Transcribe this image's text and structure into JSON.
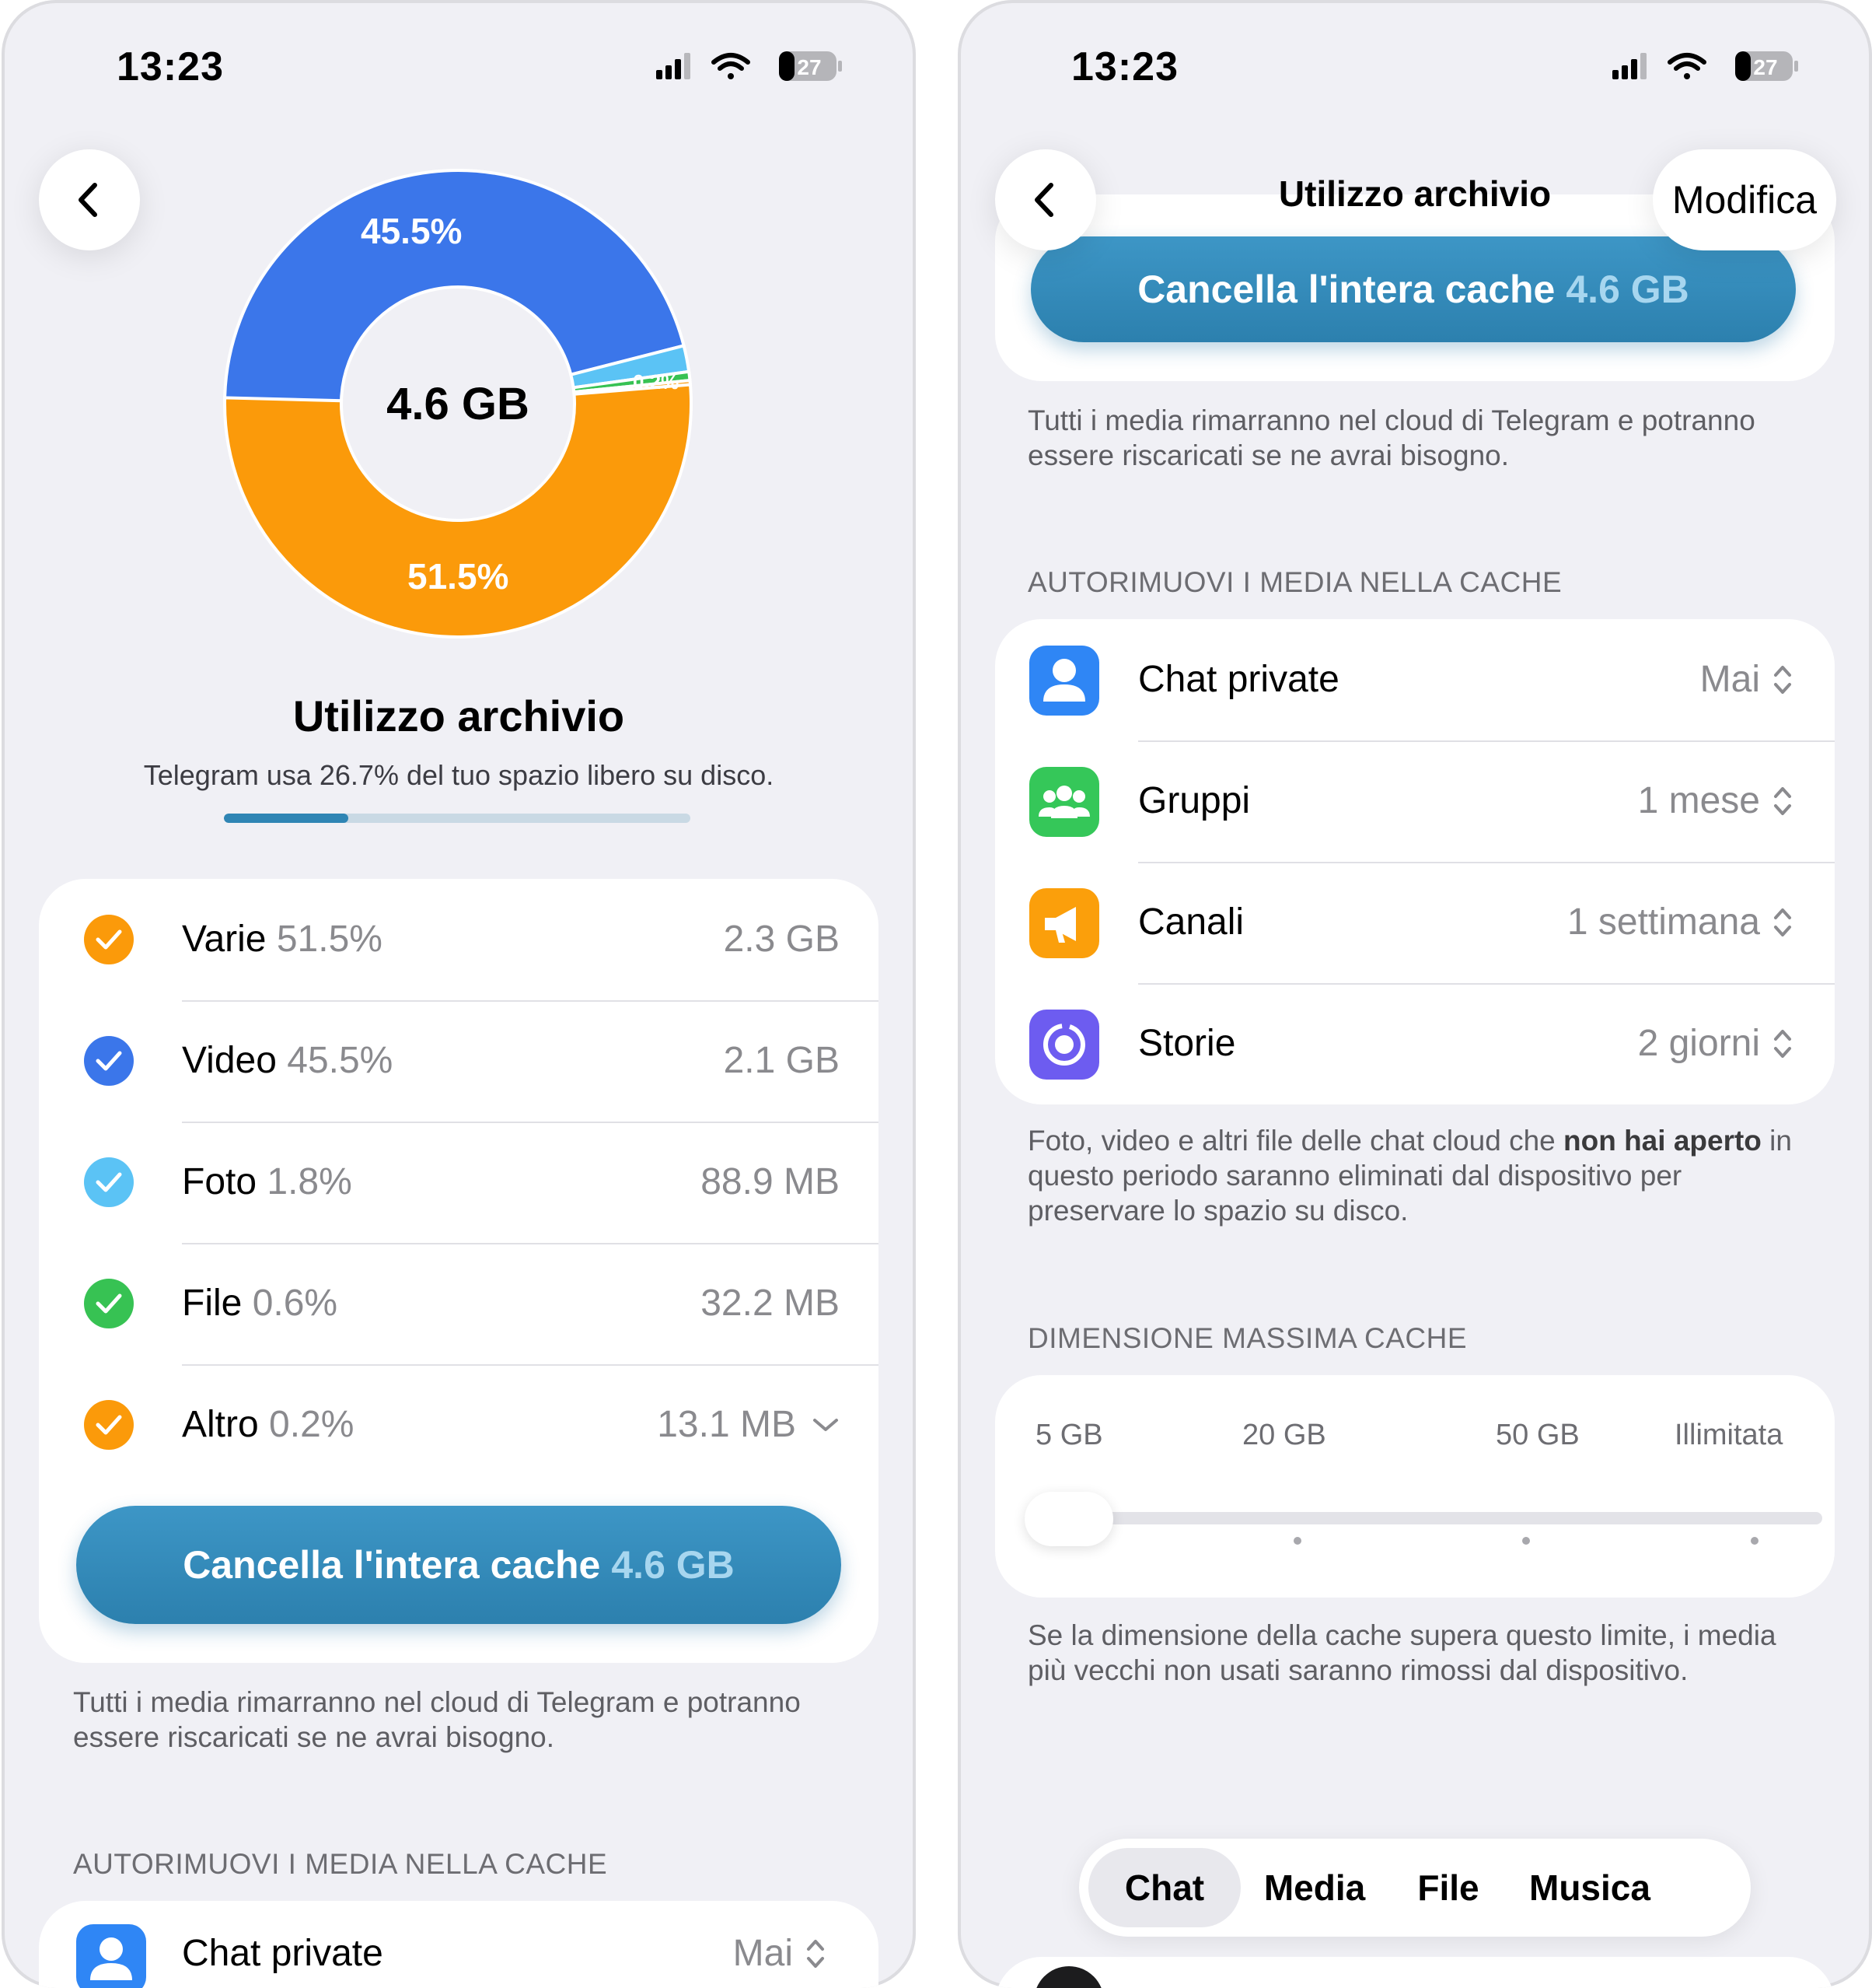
{
  "status_bar": {
    "time": "13:23",
    "battery": "27"
  },
  "left": {
    "chart_data": {
      "type": "pie",
      "center_label": "4.6 GB",
      "slice_labels": [
        "45.5%",
        "51.5%",
        "0.2%"
      ],
      "slices": [
        {
          "name": "Varie",
          "value": 51.5,
          "color": "#fb9a0a"
        },
        {
          "name": "Video",
          "value": 45.5,
          "color": "#3b76ea"
        },
        {
          "name": "Foto",
          "value": 1.8,
          "color": "#5bc3f5"
        },
        {
          "name": "File",
          "value": 0.6,
          "color": "#37c253"
        },
        {
          "name": "Altro",
          "value": 0.2,
          "color": "#fb9a0a"
        }
      ]
    },
    "title": "Utilizzo archivio",
    "subtitle": "Telegram usa 26.7% del tuo spazio libero su disco.",
    "usage_fraction": 0.267,
    "categories": [
      {
        "name": "Varie",
        "pct": "51.5%",
        "size": "2.3 GB",
        "color": "#fb9a0a"
      },
      {
        "name": "Video",
        "pct": "45.5%",
        "size": "2.1 GB",
        "color": "#3b76ea"
      },
      {
        "name": "Foto",
        "pct": "1.8%",
        "size": "88.9 MB",
        "color": "#5bc3f5"
      },
      {
        "name": "File",
        "pct": "0.6%",
        "size": "32.2 MB",
        "color": "#37c253"
      },
      {
        "name": "Altro",
        "pct": "0.2%",
        "size": "13.1 MB",
        "color": "#fb9a0a"
      }
    ],
    "clear_button": {
      "label": "Cancella l'intera cache",
      "size": "4.6 GB"
    },
    "footnote": "Tutti i media rimarranno nel cloud di Telegram e potranno essere riscaricati se ne avrai bisogno.",
    "autoremove_header": "AUTORIMUOVI I MEDIA NELLA CACHE",
    "partial_row": {
      "label": "Chat private",
      "value": "Mai"
    }
  },
  "right": {
    "nav_title": "Utilizzo archivio",
    "edit_label": "Modifica",
    "clear_button": {
      "label": "Cancella l'intera cache",
      "size": "4.6 GB"
    },
    "footnote": "Tutti i media rimarranno nel cloud di Telegram e potranno essere riscaricati se ne avrai bisogno.",
    "autoremove_header": "AUTORIMUOVI I MEDIA NELLA CACHE",
    "autoremove": [
      {
        "label": "Chat private",
        "value": "Mai",
        "icon": "person-icon",
        "color": "#2f86f5"
      },
      {
        "label": "Gruppi",
        "value": "1 mese",
        "icon": "group-icon",
        "color": "#35c759"
      },
      {
        "label": "Canali",
        "value": "1 settimana",
        "icon": "megaphone-icon",
        "color": "#fb9f0b"
      },
      {
        "label": "Storie",
        "value": "2 giorni",
        "icon": "stories-icon",
        "color": "#6d5cf0"
      }
    ],
    "autoremove_note_1": "Foto, video e altri file delle chat cloud che ",
    "autoremove_note_bold": "non hai aperto",
    "autoremove_note_2": " in questo periodo saranno eliminati dal dispositivo per preservare lo spazio su disco.",
    "max_cache_header": "DIMENSIONE MASSIMA CACHE",
    "max_cache_ticks": [
      "5 GB",
      "20 GB",
      "50 GB",
      "Illimitata"
    ],
    "max_cache_selected": "5 GB",
    "max_cache_note": "Se la dimensione della cache supera questo limite, i media più vecchi non usati saranno rimossi dal dispositivo.",
    "tabs": [
      "Chat",
      "Media",
      "File",
      "Musica"
    ],
    "active_tab": "Chat"
  }
}
